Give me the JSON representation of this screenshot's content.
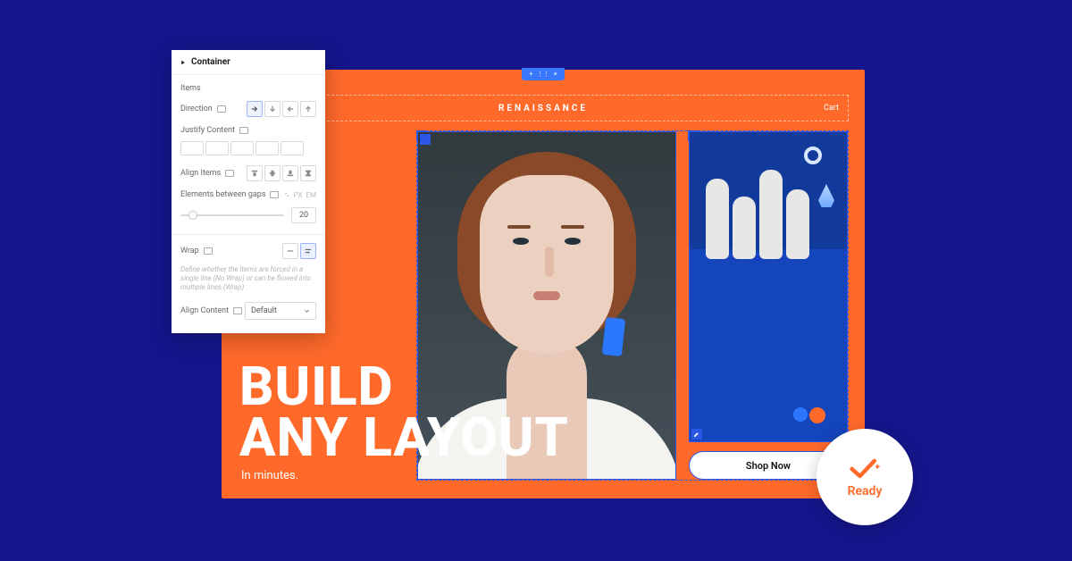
{
  "panel": {
    "title": "Container",
    "items_heading": "Items",
    "direction_label": "Direction",
    "justify_label": "Justify Content",
    "align_items_label": "Align Items",
    "gaps_label": "Elements between gaps",
    "gaps_unit_px": "PX",
    "gaps_unit_em": "EM",
    "gaps_value": "20",
    "wrap_label": "Wrap",
    "wrap_hint": "Define whether the items are forced in a single line (No Wrap) or can be flowed into multiple lines (Wrap)",
    "align_content_label": "Align Content",
    "align_content_value": "Default"
  },
  "canvas": {
    "brand": "RENAISSANCE",
    "cart": "Cart",
    "shop_btn": "Shop Now"
  },
  "headline": {
    "line1": "BUILD",
    "line2": "ANY LAYOUT",
    "sub": "In minutes."
  },
  "badge": {
    "label": "Ready"
  }
}
